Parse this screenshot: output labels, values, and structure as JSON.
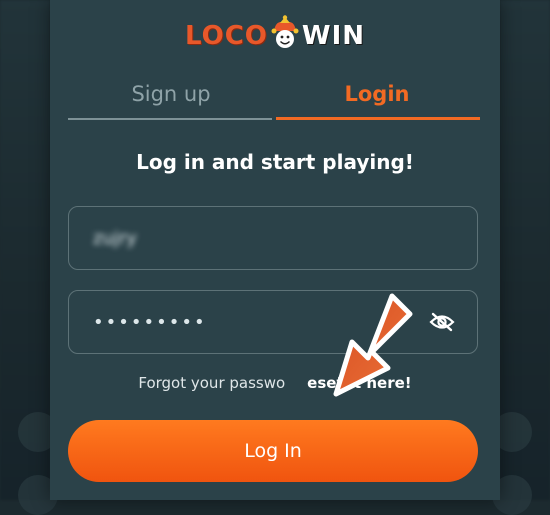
{
  "brand": {
    "logo_left": "LOCO",
    "logo_right": "WIN"
  },
  "tabs": [
    {
      "label": "Sign up",
      "active": false
    },
    {
      "label": "Login",
      "active": true
    }
  ],
  "form": {
    "heading": "Log in and start playing!",
    "username_value": "zujry",
    "password_value": "•••••••••",
    "forgot_prefix": "Forgot your passwo",
    "forgot_link": "eset it here!",
    "submit_label": "Log In"
  },
  "icons": {
    "visibility_toggle": "eye-slash-icon",
    "pointer": "arrow-pointer-icon"
  },
  "colors": {
    "accent": "#f26a23",
    "panel": "#2b4249",
    "background": "#1c2a2f"
  }
}
